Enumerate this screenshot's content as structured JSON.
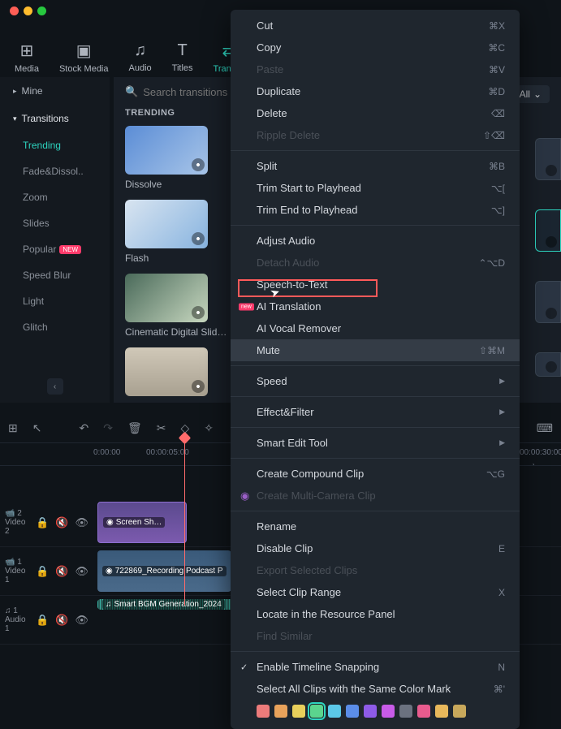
{
  "traffic_lights": [
    "close",
    "minimize",
    "zoom"
  ],
  "tabs": [
    {
      "label": "Media",
      "icon": "⊞"
    },
    {
      "label": "Stock Media",
      "icon": "▣"
    },
    {
      "label": "Audio",
      "icon": "♫"
    },
    {
      "label": "Titles",
      "icon": "T"
    },
    {
      "label": "Trans…",
      "icon": "⇄",
      "active": true
    }
  ],
  "search": {
    "placeholder": "Search transitions"
  },
  "dropdown": {
    "label": "All"
  },
  "categories": {
    "mine_label": "Mine",
    "transitions_label": "Transitions",
    "subs": [
      {
        "label": "Trending",
        "active": true
      },
      {
        "label": "Fade&Dissol..",
        "active": false
      },
      {
        "label": "Zoom",
        "active": false
      },
      {
        "label": "Slides",
        "active": false
      },
      {
        "label": "Popular",
        "active": false,
        "new": true
      },
      {
        "label": "Speed Blur",
        "active": false
      },
      {
        "label": "Light",
        "active": false
      },
      {
        "label": "Glitch",
        "active": false
      }
    ]
  },
  "section_title": "TRENDING",
  "items": [
    {
      "label": "Dissolve"
    },
    {
      "label": "Flash"
    },
    {
      "label": "Cinematic Digital Slid…"
    },
    {
      "label": ""
    }
  ],
  "timecodes": [
    "0:00:00",
    "00:00:05:00",
    "0",
    "00:00:30:00"
  ],
  "tracks": {
    "video2": {
      "id": "📹 2",
      "name": "Video 2",
      "clip": "Screen Sh…"
    },
    "video1": {
      "id": "📹 1",
      "name": "Video 1",
      "clip": "722869_Recording Podcast P"
    },
    "audio1": {
      "id": "♫ 1",
      "name": "Audio 1",
      "clip": "Smart BGM Generation_2024"
    }
  },
  "context_menu": {
    "cut": {
      "label": "Cut",
      "shortcut": "⌘X"
    },
    "copy": {
      "label": "Copy",
      "shortcut": "⌘C"
    },
    "paste": {
      "label": "Paste",
      "shortcut": "⌘V",
      "disabled": true
    },
    "duplicate": {
      "label": "Duplicate",
      "shortcut": "⌘D"
    },
    "delete": {
      "label": "Delete",
      "shortcut": "⌫"
    },
    "ripple_delete": {
      "label": "Ripple Delete",
      "shortcut": "⇧⌫",
      "disabled": true
    },
    "split": {
      "label": "Split",
      "shortcut": "⌘B"
    },
    "trim_start": {
      "label": "Trim Start to Playhead",
      "shortcut": "⌥["
    },
    "trim_end": {
      "label": "Trim End to Playhead",
      "shortcut": "⌥]"
    },
    "adjust_audio": {
      "label": "Adjust Audio"
    },
    "detach_audio": {
      "label": "Detach Audio",
      "shortcut": "⌃⌥D",
      "disabled": true
    },
    "speech_to_text": {
      "label": "Speech-to-Text"
    },
    "ai_translation": {
      "label": "AI Translation"
    },
    "ai_vocal_remover": {
      "label": "AI Vocal Remover"
    },
    "mute": {
      "label": "Mute",
      "shortcut": "⇧⌘M",
      "highlighted": true
    },
    "speed": {
      "label": "Speed"
    },
    "effect_filter": {
      "label": "Effect&Filter"
    },
    "smart_edit": {
      "label": "Smart Edit Tool"
    },
    "compound": {
      "label": "Create Compound Clip",
      "shortcut": "⌥G"
    },
    "multicam": {
      "label": "Create Multi-Camera Clip",
      "disabled": true
    },
    "rename": {
      "label": "Rename"
    },
    "disable_clip": {
      "label": "Disable Clip",
      "shortcut": "E"
    },
    "export_selected": {
      "label": "Export Selected Clips",
      "disabled": true
    },
    "select_range": {
      "label": "Select Clip Range",
      "shortcut": "X"
    },
    "locate": {
      "label": "Locate in the Resource Panel"
    },
    "find_similar": {
      "label": "Find Similar",
      "disabled": true
    },
    "timeline_snap": {
      "label": "Enable Timeline Snapping",
      "shortcut": "N",
      "checked": true
    },
    "select_color": {
      "label": "Select All Clips with the Same Color Mark",
      "shortcut": "⌘'"
    }
  },
  "colors": [
    "#ec7b7b",
    "#e8a25b",
    "#e8cf5b",
    "#5bd48e",
    "#5bc8e8",
    "#5b8de8",
    "#8e5be8",
    "#c85be8",
    "#6b7280",
    "#e85b8e",
    "#e8b85b",
    "#c8a85b"
  ],
  "selected_color_index": 3
}
